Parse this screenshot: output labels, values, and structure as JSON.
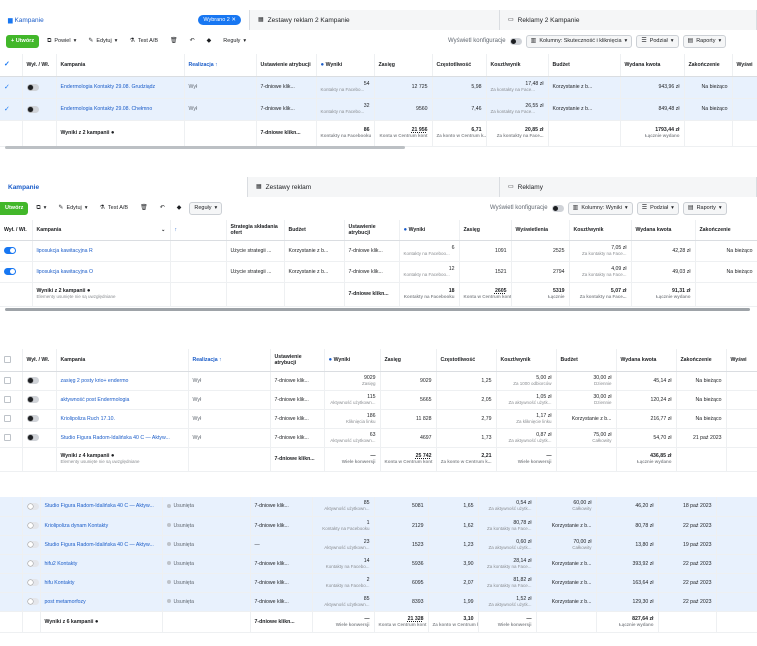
{
  "s1": {
    "tabs": [
      {
        "label": "Kampanie",
        "badge": "Wybrano 2 ✕",
        "active": true
      },
      {
        "label": "Zestawy reklam 2 Kampanie"
      },
      {
        "label": "Reklamy 2 Kampanie"
      }
    ],
    "toolbar": {
      "create": "+ Utwórz",
      "duplicate": "Powiel",
      "edit": "Edytuj",
      "ab": "Test A/B",
      "rules": "Reguły",
      "config": "Wyświetl konfiguracje",
      "columns": "Kolumny: Skuteczność i kliknięcia",
      "breakdown": "Podział",
      "reports": "Raporty"
    },
    "headers": [
      "Wył. / Wł.",
      "Kampania",
      "Realizacja ↑",
      "Ustawienie atrybucji",
      "Wyniki",
      "Zasięg",
      "Częstotliwość",
      "Koszt/wynik",
      "Budżet",
      "Wydana kwota",
      "Zakończenie",
      "Wyświ"
    ],
    "rows": [
      {
        "name": "Endermologia Kontakty 29.08. Grudziądz",
        "status": "Wył",
        "attr": "7-dniowe klik...",
        "results": "54",
        "results_sub": "Kontakty na Facebo...",
        "reach": "12 725",
        "freq": "5,98",
        "cpr": "17,48 zł",
        "cpr_sub": "Za kontakty na Face...",
        "budget": "Korzystanie z b...",
        "spent": "943,96 zł",
        "end": "Na bieżąco"
      },
      {
        "name": "Endermologia Kontakty 29.08. Chełmno",
        "status": "Wył",
        "attr": "7-dniowe klik...",
        "results": "32",
        "results_sub": "Kontakty na Facebo...",
        "reach": "9560",
        "freq": "7,46",
        "cpr": "26,55 zł",
        "cpr_sub": "Za kontakty na Face...",
        "budget": "Korzystanie z b...",
        "spent": "849,48 zł",
        "end": "Na bieżąco"
      }
    ],
    "total": {
      "label": "Wyniki z 2 kampanii",
      "attr": "7-dniowe klikn...",
      "results": "86",
      "results_sub": "Kontakty na Facebooku",
      "reach": "21 956",
      "reach_sub": "Konta w Centrum kont",
      "freq": "6,71",
      "freq_sub": "Za konto w Centrum k...",
      "cpr": "20,85 zł",
      "cpr_sub": "Za kontakty na Face...",
      "spent": "1793,44 zł",
      "spent_sub": "Łącznie wydano"
    }
  },
  "s2": {
    "tabs": [
      {
        "label": "Kampanie",
        "active": true
      },
      {
        "label": "Zestawy reklam"
      },
      {
        "label": "Reklamy"
      }
    ],
    "toolbar": {
      "create": "Utwórz",
      "edit": "Edytuj",
      "ab": "Test A/B",
      "rules": "Reguły",
      "config": "Wyświetl konfiguracje",
      "columns": "Kolumny: Wyniki",
      "breakdown": "Podział",
      "reports": "Raporty"
    },
    "headers": [
      "Wył. / Wł.",
      "Kampania",
      "↑",
      "Strategia składania ofert",
      "Budżet",
      "Ustawienie atrybucji",
      "Wyniki",
      "Zasięg",
      "Wyświetlenia",
      "Koszt/wynik",
      "Wydana kwota",
      "Zakończenie"
    ],
    "rows": [
      {
        "name": "liposukcja kawitacyjna R",
        "strategy": "Użycie strategii ...",
        "budget": "Korzystanie z b...",
        "attr": "7-dniowe klik...",
        "results": "6",
        "results_sub": "Kontakty na Faceboo...",
        "reach": "1091",
        "impr": "2525",
        "cpr": "7,05 zł",
        "cpr_sub": "Za kontakty na Face...",
        "spent": "42,28 zł",
        "end": "Na bieżąco"
      },
      {
        "name": "liposukcja kawitacyjna O",
        "strategy": "Użycie strategii ...",
        "budget": "Korzystanie z b...",
        "attr": "7-dniowe klik...",
        "results": "12",
        "results_sub": "Kontakty na Faceboo...",
        "reach": "1521",
        "impr": "2794",
        "cpr": "4,09 zł",
        "cpr_sub": "Za kontakty na Face...",
        "spent": "49,03 zł",
        "end": "Na bieżąco"
      }
    ],
    "total": {
      "label": "Wyniki z 2 kampanii",
      "sub": "Elementy usunięte nie są uwzględniane",
      "attr": "7-dniowe klikn...",
      "results": "18",
      "results_sub": "Kontakty na Facebooku",
      "reach": "2605",
      "reach_sub": "Konta w Centrum kont",
      "impr": "5319",
      "impr_sub": "Łącznie",
      "cpr": "5,07 zł",
      "cpr_sub": "Za kontakty na Face...",
      "spent": "91,31 zł",
      "spent_sub": "Łącznie wydano"
    }
  },
  "s3": {
    "headers": [
      "Wył. / Wł.",
      "Kampania",
      "Realizacja ↑",
      "Ustawienie atrybucji",
      "Wyniki",
      "Zasięg",
      "Częstotliwość",
      "Koszt/wynik",
      "Budżet",
      "Wydana kwota",
      "Zakończenie",
      "Wyświ"
    ],
    "rows": [
      {
        "name": "zasięg 2 posty krio+ endermo",
        "status": "Wył",
        "attr": "7-dniowe klik...",
        "results": "9029",
        "results_sub": "Zasięg",
        "reach": "9029",
        "freq": "1,25",
        "cpr": "5,00 zł",
        "cpr_sub": "Za 1000 odbiorców",
        "budget": "30,00 zł",
        "budget_sub": "Dziennie",
        "spent": "45,14 zł",
        "end": "Na bieżąco"
      },
      {
        "name": "aktywność post Endermologia",
        "status": "Wył",
        "attr": "7-dniowe klik...",
        "results": "115",
        "results_sub": "Aktywność użytkown...",
        "reach": "5665",
        "freq": "2,05",
        "cpr": "1,05 zł",
        "cpr_sub": "Za aktywność użytk...",
        "budget": "30,00 zł",
        "budget_sub": "Dziennie",
        "spent": "120,24 zł",
        "end": "Na bieżąco"
      },
      {
        "name": "Kriolipoliza Ruch 17.10.",
        "status": "Wył",
        "attr": "7-dniowe klik...",
        "results": "186",
        "results_sub": "Kliknięcia linku",
        "reach": "11 828",
        "freq": "2,79",
        "cpr": "1,17 zł",
        "cpr_sub": "Za kliknięcie linku",
        "budget": "Korzystanie z b...",
        "budget_sub": "",
        "spent": "216,77 zł",
        "end": "Na bieżąco"
      },
      {
        "name": "Studio Figura Radom-Idalińska 40 C — Aktyw...",
        "status": "Wył",
        "attr": "7-dniowe klik...",
        "results": "63",
        "results_sub": "Aktywność użytkown...",
        "reach": "4697",
        "freq": "1,73",
        "cpr": "0,87 zł",
        "cpr_sub": "Za aktywność użytk...",
        "budget": "75,00 zł",
        "budget_sub": "Całkowity",
        "spent": "54,70 zł",
        "end": "21 paź 2023"
      }
    ],
    "total": {
      "label": "Wyniki z 4 kampanii",
      "sub": "Elementy usunięte nie są uwzględniane",
      "attr": "7-dniowe klikn...",
      "results": "—",
      "results_sub": "Wiele konwersji",
      "reach": "25 742",
      "reach_sub": "Konta w Centrum kont",
      "freq": "2,21",
      "freq_sub": "Za konto w Centrum k...",
      "cpr": "—",
      "cpr_sub": "Wiele konwersji",
      "spent": "436,85 zł",
      "spent_sub": "Łącznie wydano"
    }
  },
  "s4": {
    "rows": [
      {
        "name": "Studio Figura Radom-Idalińska 40 C — Aktyw...",
        "status": "Usunięta",
        "attr": "7-dniowe klik...",
        "results": "85",
        "results_sub": "Aktywność użytkown...",
        "reach": "5081",
        "freq": "1,65",
        "cpr": "0,54 zł",
        "cpr_sub": "Za aktywność użytk...",
        "budget": "60,00 zł",
        "budget_sub": "Całkowity",
        "spent": "46,20 zł",
        "end": "18 paź 2023"
      },
      {
        "name": "Kriolipoliza dynam Kontakty",
        "status": "Usunięta",
        "attr": "7-dniowe klik...",
        "results": "1",
        "results_sub": "Kontakty na Facebooku",
        "reach": "2129",
        "freq": "1,62",
        "cpr": "80,78 zł",
        "cpr_sub": "Za kontakty na Face...",
        "budget": "Korzystanie z b...",
        "budget_sub": "",
        "spent": "80,78 zł",
        "end": "22 paź 2023"
      },
      {
        "name": "Studio Figura Radom-Idalińska 40 C — Aktyw...",
        "status": "Usunięta",
        "attr": "—",
        "results": "23",
        "results_sub": "Aktywność użytkown...",
        "reach": "1523",
        "freq": "1,23",
        "cpr": "0,60 zł",
        "cpr_sub": "Za aktywność użytk...",
        "budget": "70,00 zł",
        "budget_sub": "Całkowity",
        "spent": "13,80 zł",
        "end": "19 paź 2023"
      },
      {
        "name": "hifu2 Kontakty",
        "status": "Usunięta",
        "attr": "7-dniowe klik...",
        "results": "14",
        "results_sub": "Kontakty na Facebo...",
        "reach": "5936",
        "freq": "3,90",
        "cpr": "28,14 zł",
        "cpr_sub": "Za kontakty na Face...",
        "budget": "Korzystanie z b...",
        "budget_sub": "",
        "spent": "393,92 zł",
        "end": "22 paź 2023"
      },
      {
        "name": "hifu Kontakty",
        "status": "Usunięta",
        "attr": "7-dniowe klik...",
        "results": "2",
        "results_sub": "Kontakty na Facebo...",
        "reach": "6095",
        "freq": "2,07",
        "cpr": "81,82 zł",
        "cpr_sub": "Za kontakty na Face...",
        "budget": "Korzystanie z b...",
        "budget_sub": "",
        "spent": "163,64 zł",
        "end": "22 paź 2023"
      },
      {
        "name": "post metamorfozy",
        "status": "Usunięta",
        "attr": "7-dniowe klik...",
        "results": "85",
        "results_sub": "Aktywność użytkown...",
        "reach": "8393",
        "freq": "1,99",
        "cpr": "1,52 zł",
        "cpr_sub": "Za aktywność użytk...",
        "budget": "Korzystanie z b...",
        "budget_sub": "",
        "spent": "129,30 zł",
        "end": "22 paź 2023"
      }
    ],
    "total": {
      "label": "Wyniki z 6 kampanii",
      "attr": "7-dniowe klikn...",
      "results": "—",
      "results_sub": "Wiele konwersji",
      "reach": "21 328",
      "reach_sub": "Konta w Centrum kont",
      "freq": "3,10",
      "freq_sub": "Za konto w Centrum k...",
      "cpr": "—",
      "cpr_sub": "Wiele konwersji",
      "spent": "827,64 zł",
      "spent_sub": "Łącznie wydano"
    }
  }
}
